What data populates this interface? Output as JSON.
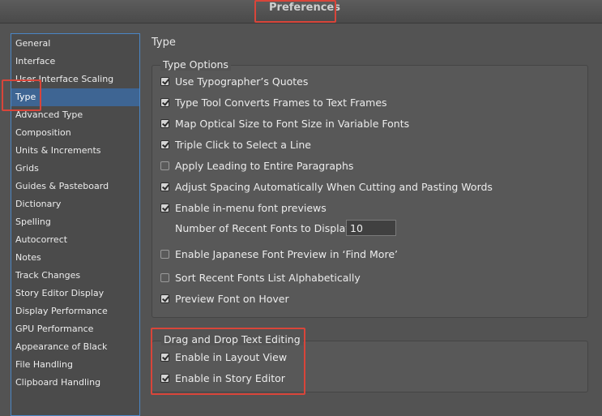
{
  "window": {
    "title": "Preferences"
  },
  "sidebar": {
    "items": [
      {
        "label": "General"
      },
      {
        "label": "Interface"
      },
      {
        "label": "User Interface Scaling"
      },
      {
        "label": "Type",
        "selected": true
      },
      {
        "label": "Advanced Type"
      },
      {
        "label": "Composition"
      },
      {
        "label": "Units & Increments"
      },
      {
        "label": "Grids"
      },
      {
        "label": "Guides & Pasteboard"
      },
      {
        "label": "Dictionary"
      },
      {
        "label": "Spelling"
      },
      {
        "label": "Autocorrect"
      },
      {
        "label": "Notes"
      },
      {
        "label": "Track Changes"
      },
      {
        "label": "Story Editor Display"
      },
      {
        "label": "Display Performance"
      },
      {
        "label": "GPU Performance"
      },
      {
        "label": "Appearance of Black"
      },
      {
        "label": "File Handling"
      },
      {
        "label": "Clipboard Handling"
      }
    ]
  },
  "panel": {
    "title": "Type",
    "type_options": {
      "label": "Type Options",
      "options": [
        {
          "label": "Use Typographer’s Quotes",
          "checked": true
        },
        {
          "label": "Type Tool Converts Frames to Text Frames",
          "checked": true
        },
        {
          "label": "Map Optical Size to Font Size in Variable Fonts",
          "checked": true
        },
        {
          "label": "Triple Click to Select a Line",
          "checked": true
        },
        {
          "label": "Apply Leading to Entire Paragraphs",
          "checked": false
        },
        {
          "label": "Adjust Spacing Automatically When Cutting and Pasting Words",
          "checked": true
        },
        {
          "label": "Enable in-menu font previews",
          "checked": true
        }
      ],
      "recent_fonts_label": "Number of Recent Fonts to Display:",
      "recent_fonts_value": "10",
      "more_options": [
        {
          "label": "Enable Japanese Font Preview in ‘Find More’",
          "checked": false
        },
        {
          "label": "Sort Recent Fonts List Alphabetically",
          "checked": false
        },
        {
          "label": "Preview Font on Hover",
          "checked": true
        }
      ]
    },
    "drag_drop": {
      "label": "Drag and Drop Text Editing",
      "options": [
        {
          "label": "Enable in Layout View",
          "checked": true
        },
        {
          "label": "Enable in Story Editor",
          "checked": true
        }
      ]
    }
  },
  "colors": {
    "selection": "#3e6593",
    "callout": "#d9453a",
    "background": "#535353"
  }
}
